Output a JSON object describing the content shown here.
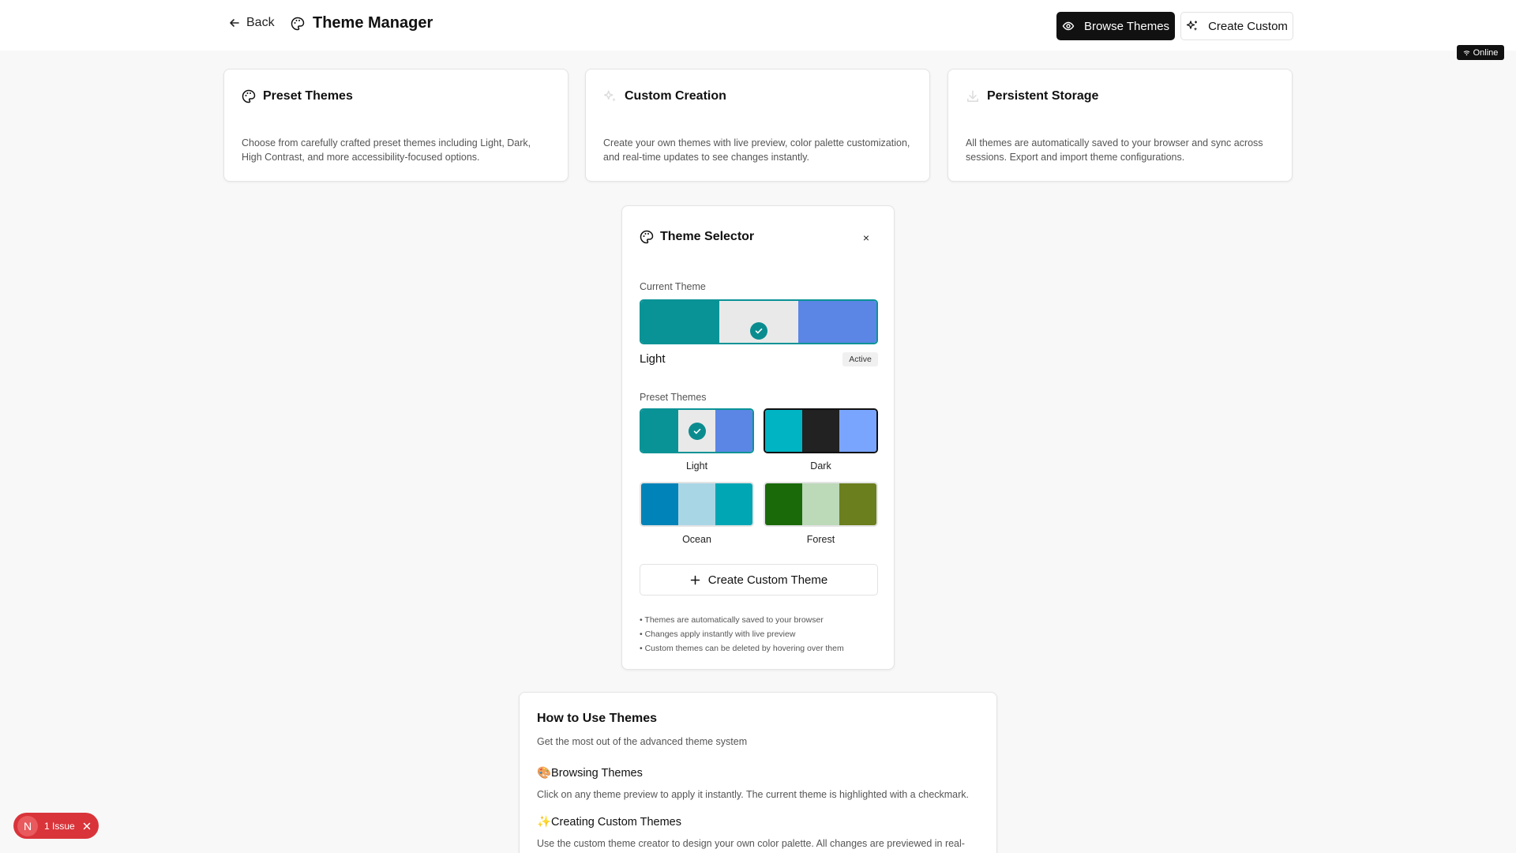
{
  "header": {
    "back_label": "Back",
    "title": "Theme Manager",
    "browse_label": "Browse Themes",
    "create_label": "Create Custom"
  },
  "status": {
    "online": "Online"
  },
  "features": [
    {
      "title": "Preset Themes",
      "description": "Choose from carefully crafted preset themes including Light, Dark, High Contrast, and more accessibility-focused options.",
      "icon": "palette-icon"
    },
    {
      "title": "Custom Creation",
      "description": "Create your own themes with live preview, color palette customization, and real-time updates to see changes instantly.",
      "icon": "sparkles-icon"
    },
    {
      "title": "Persistent Storage",
      "description": "All themes are automatically saved to your browser and sync across sessions. Export and import theme configurations.",
      "icon": "download-icon"
    }
  ],
  "selector": {
    "title": "Theme Selector",
    "close": "×",
    "current_label": "Current Theme",
    "current_name": "Light",
    "active_badge": "Active",
    "current_colors": [
      "#0a9396",
      "#e9e9e9",
      "#5b86e5"
    ],
    "preset_label": "Preset Themes",
    "presets": [
      {
        "name": "Light",
        "colors": [
          "#0a9396",
          "#e9e9e9",
          "#5b86e5"
        ],
        "selected": true
      },
      {
        "name": "Dark",
        "colors": [
          "#00b4c4",
          "#222222",
          "#7aa5ff"
        ],
        "selected": false
      },
      {
        "name": "Ocean",
        "colors": [
          "#0083b8",
          "#a9d6e5",
          "#00a6b4"
        ],
        "selected": false
      },
      {
        "name": "Forest",
        "colors": [
          "#1a6a0a",
          "#bcd9b8",
          "#6b7f1e"
        ],
        "selected": false
      }
    ],
    "create_button": "Create Custom Theme",
    "notes": [
      "• Themes are automatically saved to your browser",
      "• Changes apply instantly with live preview",
      "• Custom themes can be deleted by hovering over them"
    ]
  },
  "howto": {
    "title": "How to Use Themes",
    "subtitle": "Get the most out of the advanced theme system",
    "sections": [
      {
        "title": "🎨Browsing Themes",
        "text": "Click on any theme preview to apply it instantly. The current theme is highlighted with a checkmark."
      },
      {
        "title": "✨Creating Custom Themes",
        "text": "Use the custom theme creator to design your own color palette. All changes are previewed in real-"
      }
    ]
  },
  "issue_badge": {
    "initial": "N",
    "label": "1 Issue"
  }
}
